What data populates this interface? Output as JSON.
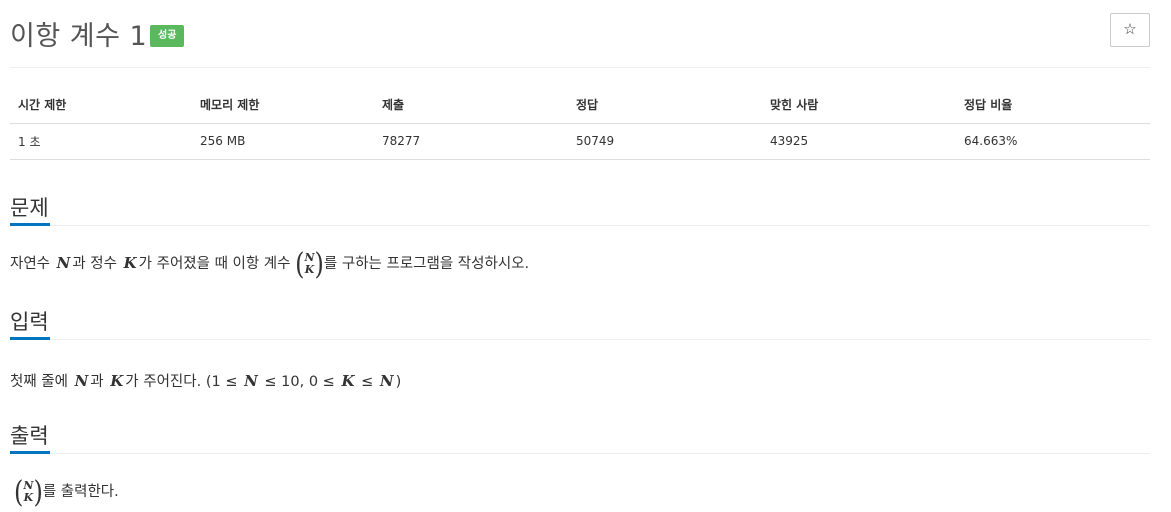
{
  "header": {
    "title": "이항 계수 1",
    "badge": "성공",
    "star_icon": "☆"
  },
  "info_table": {
    "headers": [
      "시간 제한",
      "메모리 제한",
      "제출",
      "정답",
      "맞힌 사람",
      "정답 비율"
    ],
    "values": [
      "1 초",
      "256 MB",
      "78277",
      "50749",
      "43925",
      "64.663%"
    ]
  },
  "sections": {
    "problem": {
      "title": "문제",
      "text_1": "자연수",
      "var_n": "N",
      "text_2": "과 정수",
      "var_k": "K",
      "text_3": "가 주어졌을 때 이항 계수",
      "text_4": "를 구하는 프로그램을 작성하시오."
    },
    "input": {
      "title": "입력",
      "text_1": "첫째 줄에",
      "var_n": "N",
      "text_2": "과",
      "var_k": "K",
      "text_3": "가 주어진다. (1 ≤",
      "var_n2": "N",
      "text_4": "≤ 10, 0 ≤",
      "var_k2": "K",
      "text_5": "≤",
      "var_n3": "N",
      "text_6": ")"
    },
    "output": {
      "title": "출력",
      "text_1": "를 출력한다."
    }
  },
  "binom": {
    "top": "N",
    "bottom": "K",
    "left_paren": "(",
    "right_paren": ")"
  },
  "colors": {
    "badge_success": "#5cb85c",
    "section_underline": "#0076c0"
  }
}
